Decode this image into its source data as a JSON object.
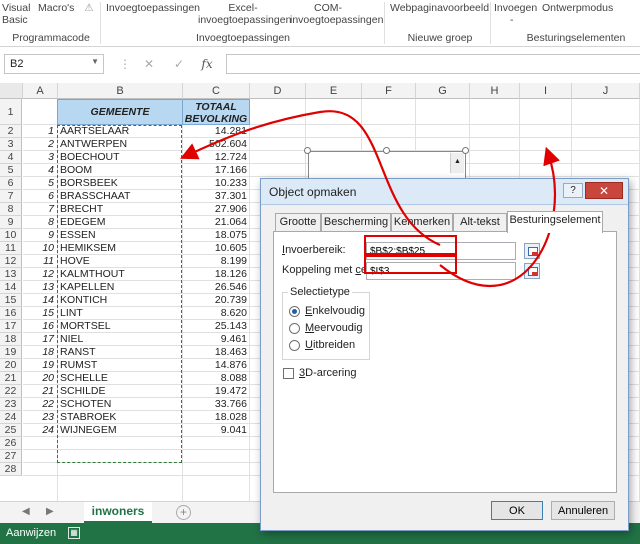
{
  "ribbon": {
    "visual_basic": "Visual Basic",
    "macros": "Macro's",
    "add_ins": "Invoegtoepassingen",
    "excel_add_ins": "Excel-invoegtoepassingen",
    "com_add_ins": "COM-invoegtoepassingen",
    "web_preview": "Webpaginavoorbeeld",
    "insert": "Invoegen",
    "insert_arrow": "-",
    "design_mode": "Ontwerpmodus",
    "groups": {
      "code": "Programmacode",
      "add_ins": "Invoegtoepassingen",
      "new_group": "Nieuwe groep",
      "controls": "Besturingselementen"
    }
  },
  "formula_bar": {
    "name_box": "B2",
    "fx": "fx",
    "cancel": "✕",
    "enter": "✓",
    "more": "⋮",
    "formula": ""
  },
  "sheet": {
    "columns": [
      "A",
      "B",
      "C",
      "D",
      "E",
      "F",
      "G",
      "H",
      "I",
      "J"
    ],
    "rows": [
      "1",
      "2",
      "3",
      "4",
      "5",
      "6",
      "7",
      "8",
      "9",
      "10",
      "11",
      "12",
      "13",
      "14",
      "15",
      "16",
      "17",
      "18",
      "19",
      "20",
      "21",
      "22",
      "23",
      "24",
      "25",
      "26",
      "27",
      "28"
    ],
    "header_b": "GEMEENTE",
    "header_c": "TOTAAL BEVOLKING",
    "data": [
      {
        "n": "1",
        "name": "AARTSELAAR",
        "pop": "14.281"
      },
      {
        "n": "2",
        "name": "ANTWERPEN",
        "pop": "502.604"
      },
      {
        "n": "3",
        "name": "BOECHOUT",
        "pop": "12.724"
      },
      {
        "n": "4",
        "name": "BOOM",
        "pop": "17.166"
      },
      {
        "n": "5",
        "name": "BORSBEEK",
        "pop": "10.233"
      },
      {
        "n": "6",
        "name": "BRASSCHAAT",
        "pop": "37.301"
      },
      {
        "n": "7",
        "name": "BRECHT",
        "pop": "27.906"
      },
      {
        "n": "8",
        "name": "EDEGEM",
        "pop": "21.064"
      },
      {
        "n": "9",
        "name": "ESSEN",
        "pop": "18.075"
      },
      {
        "n": "10",
        "name": "HEMIKSEM",
        "pop": "10.605"
      },
      {
        "n": "11",
        "name": "HOVE",
        "pop": "8.199"
      },
      {
        "n": "12",
        "name": "KALMTHOUT",
        "pop": "18.126"
      },
      {
        "n": "13",
        "name": "KAPELLEN",
        "pop": "26.546"
      },
      {
        "n": "14",
        "name": "KONTICH",
        "pop": "20.739"
      },
      {
        "n": "15",
        "name": "LINT",
        "pop": "8.620"
      },
      {
        "n": "16",
        "name": "MORTSEL",
        "pop": "25.143"
      },
      {
        "n": "17",
        "name": "NIEL",
        "pop": "9.461"
      },
      {
        "n": "18",
        "name": "RANST",
        "pop": "18.463"
      },
      {
        "n": "19",
        "name": "RUMST",
        "pop": "14.876"
      },
      {
        "n": "20",
        "name": "SCHELLE",
        "pop": "8.088"
      },
      {
        "n": "21",
        "name": "SCHILDE",
        "pop": "19.472"
      },
      {
        "n": "22",
        "name": "SCHOTEN",
        "pop": "33.766"
      },
      {
        "n": "23",
        "name": "STABROEK",
        "pop": "18.028"
      },
      {
        "n": "24",
        "name": "WIJNEGEM",
        "pop": "9.041"
      }
    ]
  },
  "tabs": {
    "sheet_name": "inwoners",
    "prev": "◀",
    "next": "▶",
    "add": "+"
  },
  "status": {
    "text": "Aanwijzen",
    "macro_icon": "▦"
  },
  "dialog": {
    "title": "Object opmaken",
    "help": "?",
    "close": "✕",
    "tabs": [
      "Grootte",
      "Bescherming",
      "Kenmerken",
      "Alt-tekst",
      "Besturingselement"
    ],
    "input_range_label": "Invoerbereik:",
    "input_range_value": "$B$2:$B$25",
    "cell_link_label": "Koppeling met cel:",
    "cell_link_value": "$I$3",
    "selection_type": "Selectietype",
    "radio_single": "Enkelvoudig",
    "radio_multi": "Meervoudig",
    "radio_extend": "Uitbreiden",
    "shading_3d": "3D-arcering",
    "ok": "OK",
    "cancel": "Annuleren"
  },
  "colors": {
    "excel_green": "#217346",
    "header_blue": "#b8d7f0",
    "annotation_red": "#e00000",
    "marquee_green": "#2e7d32"
  }
}
